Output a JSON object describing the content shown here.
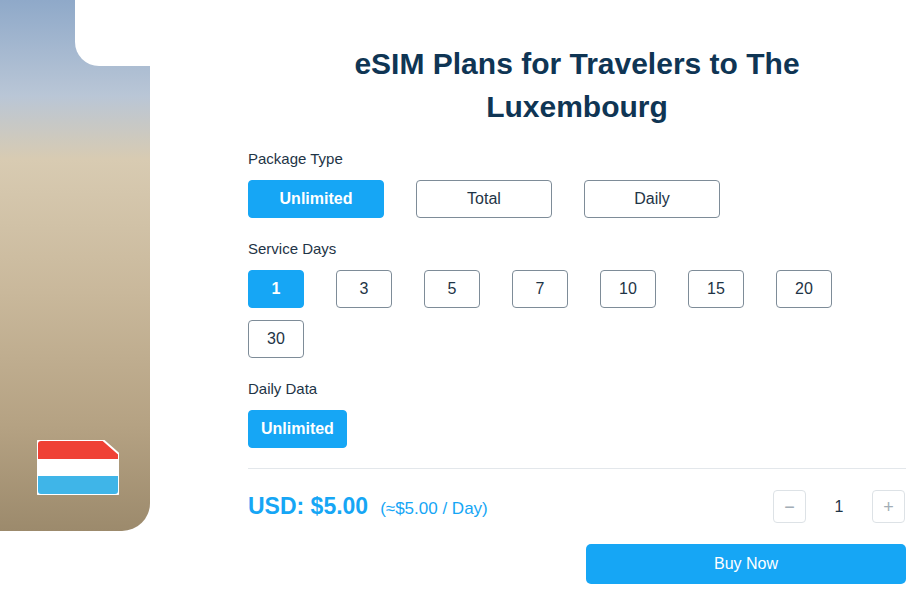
{
  "title": "eSIM Plans for Travelers to The Luxembourg",
  "package_type": {
    "label": "Package Type",
    "options": [
      {
        "label": "Unlimited",
        "selected": true
      },
      {
        "label": "Total",
        "selected": false
      },
      {
        "label": "Daily",
        "selected": false
      }
    ]
  },
  "service_days": {
    "label": "Service Days",
    "options": [
      {
        "label": "1",
        "selected": true
      },
      {
        "label": "3",
        "selected": false
      },
      {
        "label": "5",
        "selected": false
      },
      {
        "label": "7",
        "selected": false
      },
      {
        "label": "10",
        "selected": false
      },
      {
        "label": "15",
        "selected": false
      },
      {
        "label": "20",
        "selected": false
      },
      {
        "label": "30",
        "selected": false
      }
    ]
  },
  "daily_data": {
    "label": "Daily Data",
    "options": [
      {
        "label": "Unlimited",
        "selected": true
      }
    ]
  },
  "price": {
    "amount": "USD: $5.00",
    "per_day": "(≈$5.00 / Day)"
  },
  "quantity": {
    "minus": "−",
    "value": "1",
    "plus": "+"
  },
  "buy_button": "Buy Now"
}
